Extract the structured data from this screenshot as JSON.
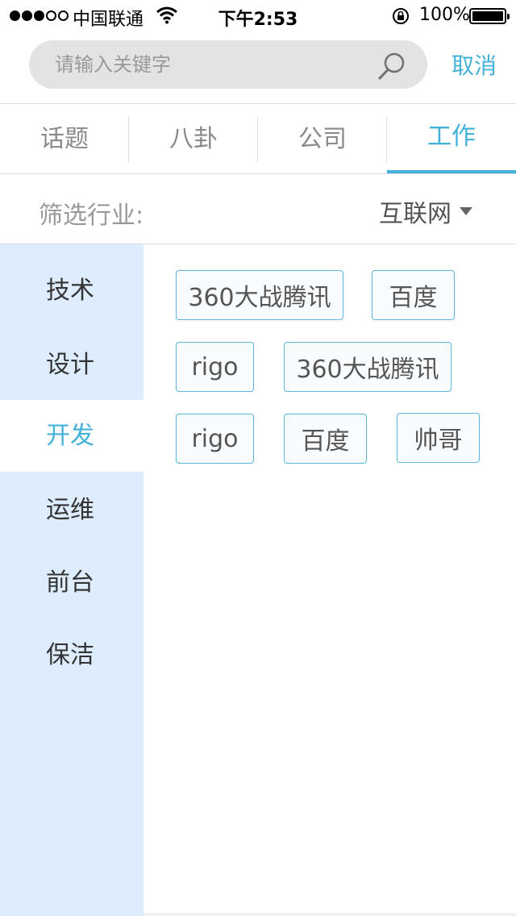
{
  "status_bar": {
    "carrier": "中国联通",
    "time": "下午2:53",
    "battery": "100%"
  },
  "search": {
    "placeholder": "请输入关键字",
    "cancel_label": "取消"
  },
  "tabs": [
    {
      "label": "话题",
      "active": false
    },
    {
      "label": "八卦",
      "active": false
    },
    {
      "label": "公司",
      "active": false
    },
    {
      "label": "工作",
      "active": true
    }
  ],
  "filter": {
    "label": "筛选行业:",
    "value": "互联网"
  },
  "categories": [
    {
      "label": "技术",
      "active": false
    },
    {
      "label": "设计",
      "active": false
    },
    {
      "label": "开发",
      "active": true
    },
    {
      "label": "运维",
      "active": false
    },
    {
      "label": "前台",
      "active": false
    },
    {
      "label": "保洁",
      "active": false
    }
  ],
  "tags": [
    "360大战腾讯",
    "百度",
    "rigo",
    "360大战腾讯",
    "rigo",
    "百度",
    "帅哥"
  ],
  "colors": {
    "accent": "#43b1d9",
    "sidebar_bg": "#deedfd",
    "search_bg": "#e3e3e3"
  }
}
